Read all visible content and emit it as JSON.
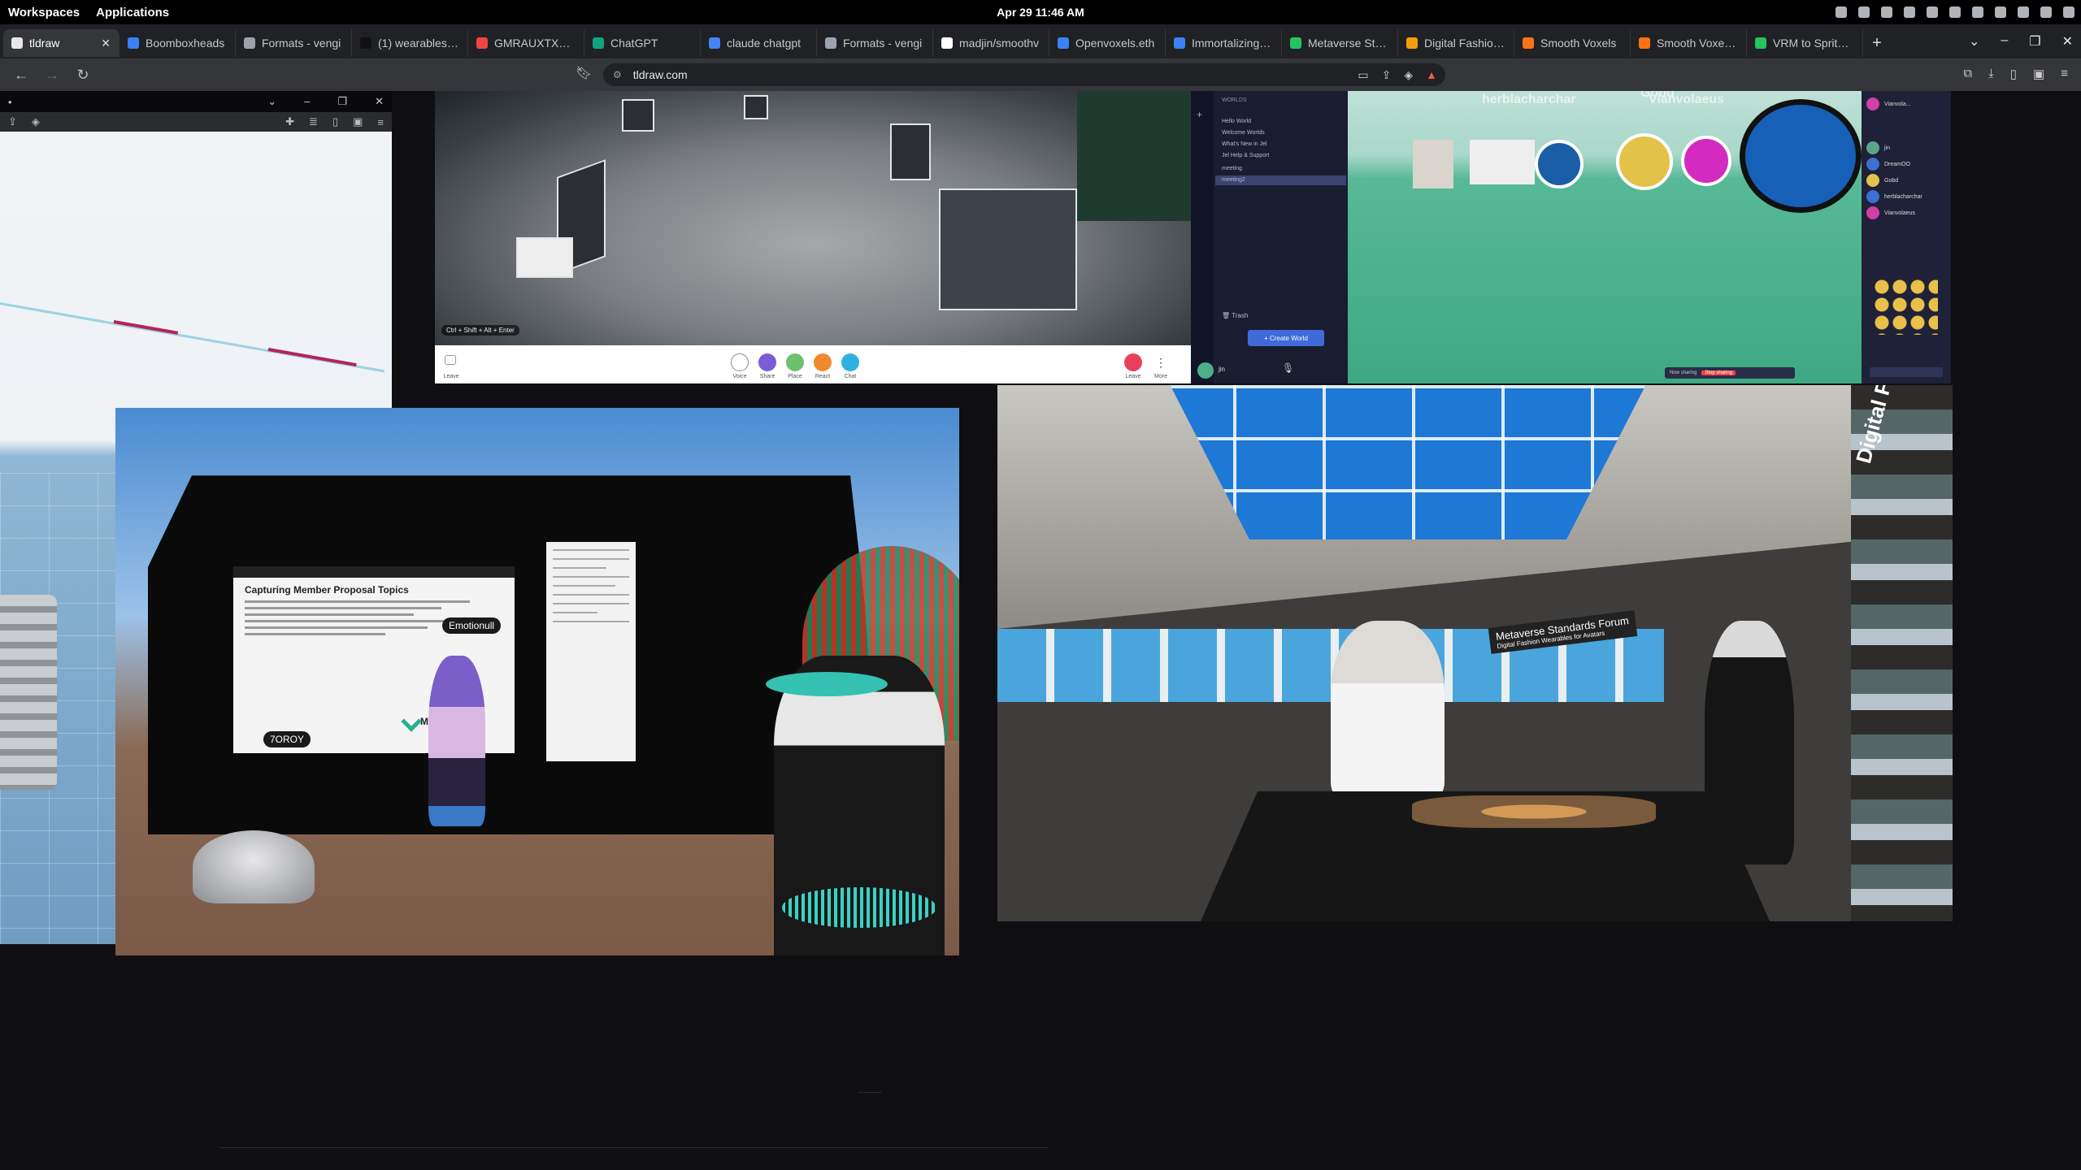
{
  "topbar": {
    "workspaces": "Workspaces",
    "applications": "Applications",
    "clock": "Apr 29  11:46 AM"
  },
  "tabs": [
    {
      "label": "tldraw",
      "active": true,
      "color": "#e8e8e8"
    },
    {
      "label": "Boomboxheads",
      "color": "#3b82f6"
    },
    {
      "label": "Formats - vengi",
      "color": "#9ca3af"
    },
    {
      "label": "(1) wearables fro",
      "color": "#111111"
    },
    {
      "label": "GMRAUXTXWAAdi",
      "color": "#ef4444"
    },
    {
      "label": "ChatGPT",
      "color": "#10a37f"
    },
    {
      "label": "claude chatgpt",
      "color": "#4285f4"
    },
    {
      "label": "Formats - vengi",
      "color": "#9ca3af"
    },
    {
      "label": "madjin/smoothv",
      "color": "#ffffff"
    },
    {
      "label": "Openvoxels.eth",
      "color": "#3b82f6"
    },
    {
      "label": "Immortalizing W",
      "color": "#3b82f6"
    },
    {
      "label": "Metaverse Stand",
      "color": "#22c55e"
    },
    {
      "label": "Digital Fashion W",
      "color": "#f59e0b"
    },
    {
      "label": "Smooth Voxels",
      "color": "#f97316"
    },
    {
      "label": "Smooth Voxel Pl",
      "color": "#f97316"
    },
    {
      "label": "VRM to Spritesh",
      "color": "#22c55e"
    }
  ],
  "toolbar": {
    "url": "tldraw.com"
  },
  "scene1": {
    "caption": "Ctrl + Shift + Alt + Enter",
    "callbar": [
      "Leave",
      "Voice",
      "Share",
      "Place",
      "React",
      "Chat",
      "Leave",
      "More"
    ]
  },
  "scene2": {
    "section_heading": "WORLDS",
    "rooms": [
      "Hello World",
      "Welcome Worlds",
      "What's New in Jel",
      "Jel Help & Support",
      "meeting",
      "meeting2"
    ],
    "trash": "Trash",
    "create_button": "Create World",
    "user": "jin",
    "usernames": [
      "herblacharchar",
      "Gobd",
      "Vianvolaeus"
    ],
    "members": [
      "Vianvola...",
      "jin",
      "DreamOO",
      "Gobd",
      "herblacharchar",
      "Vianvolaeus"
    ],
    "status_text": "Now sharing",
    "status_button": "Stop sharing"
  },
  "scene3": {
    "slide_title": "Capturing Member Proposal Topics",
    "name_tag_1": "7OROY",
    "name_tag_2": "Emotionull",
    "logo_text": "Metaverse"
  },
  "scene4": {
    "sign_title": "Metaverse Standards Forum",
    "sign_sub": "Digital Fashion Wearables for Avatars",
    "brand": "Digital Fashion Wear"
  }
}
